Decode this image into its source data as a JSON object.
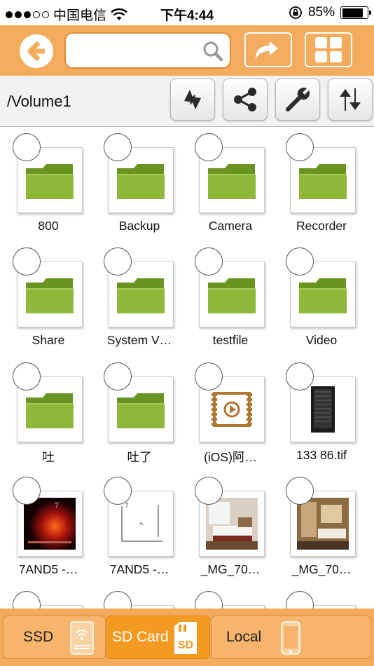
{
  "status_bar": {
    "carrier": "中国电信",
    "time": "下午4:44",
    "battery": "85%",
    "battery_level": 0.85
  },
  "toolbar": {
    "back_icon": "back-arrow-icon",
    "search": {
      "value": "",
      "placeholder": ""
    },
    "share_icon": "forward-share-icon",
    "view_icon": "grid-view-icon"
  },
  "pathbar": {
    "path": "/Volume1",
    "actions": [
      {
        "icon": "refresh-icon"
      },
      {
        "icon": "share-icon"
      },
      {
        "icon": "wrench-icon"
      },
      {
        "icon": "sort-icon"
      }
    ]
  },
  "files": [
    {
      "name": "800",
      "type": "folder"
    },
    {
      "name": "Backup",
      "type": "folder"
    },
    {
      "name": "Camera",
      "type": "folder"
    },
    {
      "name": "Recorder",
      "type": "folder"
    },
    {
      "name": "Share",
      "type": "folder"
    },
    {
      "name": "System V…",
      "type": "folder"
    },
    {
      "name": "testfile",
      "type": "folder"
    },
    {
      "name": "Video",
      "type": "folder"
    },
    {
      "name": "吐",
      "type": "folder"
    },
    {
      "name": "吐了",
      "type": "folder"
    },
    {
      "name": "(iOS)阿…",
      "type": "video"
    },
    {
      "name": "133 86.tif",
      "type": "image-cabinet"
    },
    {
      "name": "7AND5 -…",
      "type": "image-album-red"
    },
    {
      "name": "7AND5 -…",
      "type": "image-album-white"
    },
    {
      "name": "_MG_70…",
      "type": "image-hotel-bed"
    },
    {
      "name": "_MG_70…",
      "type": "image-hotel-room"
    }
  ],
  "tabs": [
    {
      "label": "SSD",
      "icon": "ssd-drive-icon",
      "active": false
    },
    {
      "label": "SD Card",
      "icon": "sd-card-icon",
      "active": true,
      "icon_text": "SD"
    },
    {
      "label": "Local",
      "icon": "phone-icon",
      "active": false
    }
  ],
  "colors": {
    "accent": "#f3ab5e",
    "active_tab": "#f39a22",
    "folder_green": "#7aa22a"
  }
}
